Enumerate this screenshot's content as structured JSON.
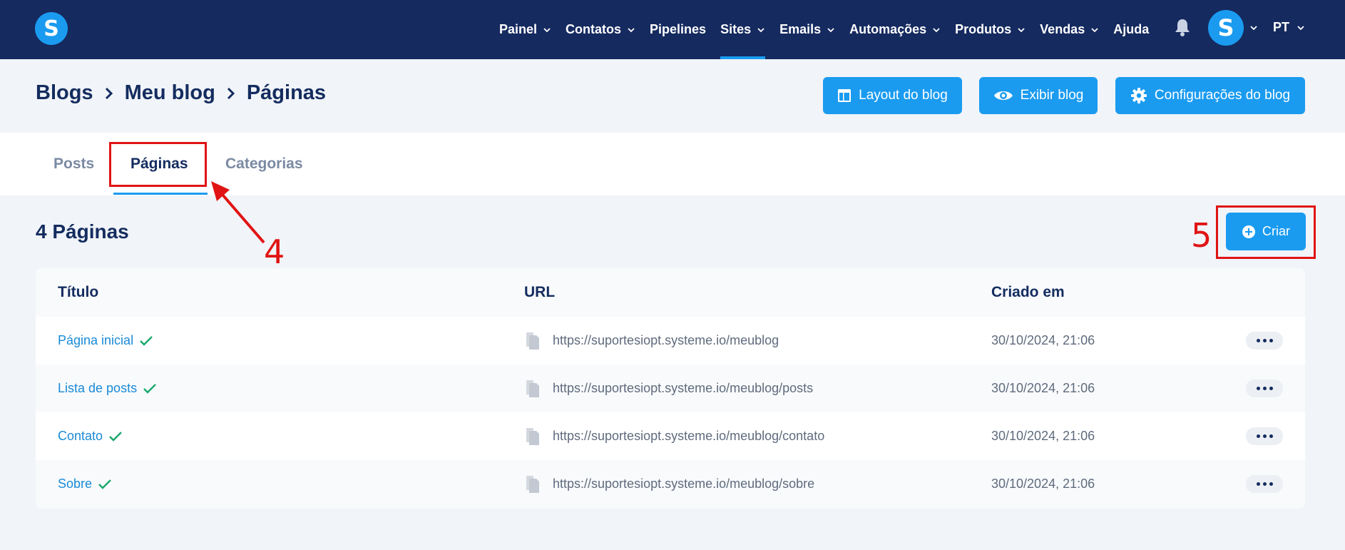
{
  "topnav": {
    "logo_letter": "S",
    "items": [
      {
        "label": "Painel",
        "has_chevron": true,
        "active": false
      },
      {
        "label": "Contatos",
        "has_chevron": true,
        "active": false
      },
      {
        "label": "Pipelines",
        "has_chevron": false,
        "active": false
      },
      {
        "label": "Sites",
        "has_chevron": true,
        "active": true
      },
      {
        "label": "Emails",
        "has_chevron": true,
        "active": false
      },
      {
        "label": "Automações",
        "has_chevron": true,
        "active": false
      },
      {
        "label": "Produtos",
        "has_chevron": true,
        "active": false
      },
      {
        "label": "Vendas",
        "has_chevron": true,
        "active": false
      },
      {
        "label": "Ajuda",
        "has_chevron": false,
        "active": false
      }
    ],
    "avatar_letter": "S",
    "language": "PT"
  },
  "breadcrumb": [
    "Blogs",
    "Meu blog",
    "Páginas"
  ],
  "header_buttons": {
    "layout": "Layout do blog",
    "view": "Exibir blog",
    "settings": "Configurações do blog"
  },
  "tabs": [
    {
      "label": "Posts",
      "active": false
    },
    {
      "label": "Páginas",
      "active": true
    },
    {
      "label": "Categorias",
      "active": false
    }
  ],
  "section": {
    "title": "4 Páginas",
    "create_label": "Criar"
  },
  "table": {
    "columns": [
      "Título",
      "URL",
      "Criado em"
    ],
    "rows": [
      {
        "title": "Página inicial",
        "url": "https://suportesiopt.systeme.io/meublog",
        "created": "30/10/2024, 21:06"
      },
      {
        "title": "Lista de posts",
        "url": "https://suportesiopt.systeme.io/meublog/posts",
        "created": "30/10/2024, 21:06"
      },
      {
        "title": "Contato",
        "url": "https://suportesiopt.systeme.io/meublog/contato",
        "created": "30/10/2024, 21:06"
      },
      {
        "title": "Sobre",
        "url": "https://suportesiopt.systeme.io/meublog/sobre",
        "created": "30/10/2024, 21:06"
      }
    ]
  },
  "annotations": {
    "step_tab": "4",
    "step_create": "5",
    "color": "#e01414"
  },
  "colors": {
    "nav_bg": "#152a5f",
    "accent": "#1a9bf0",
    "link": "#1a8ad6",
    "check": "#1aa86b"
  }
}
